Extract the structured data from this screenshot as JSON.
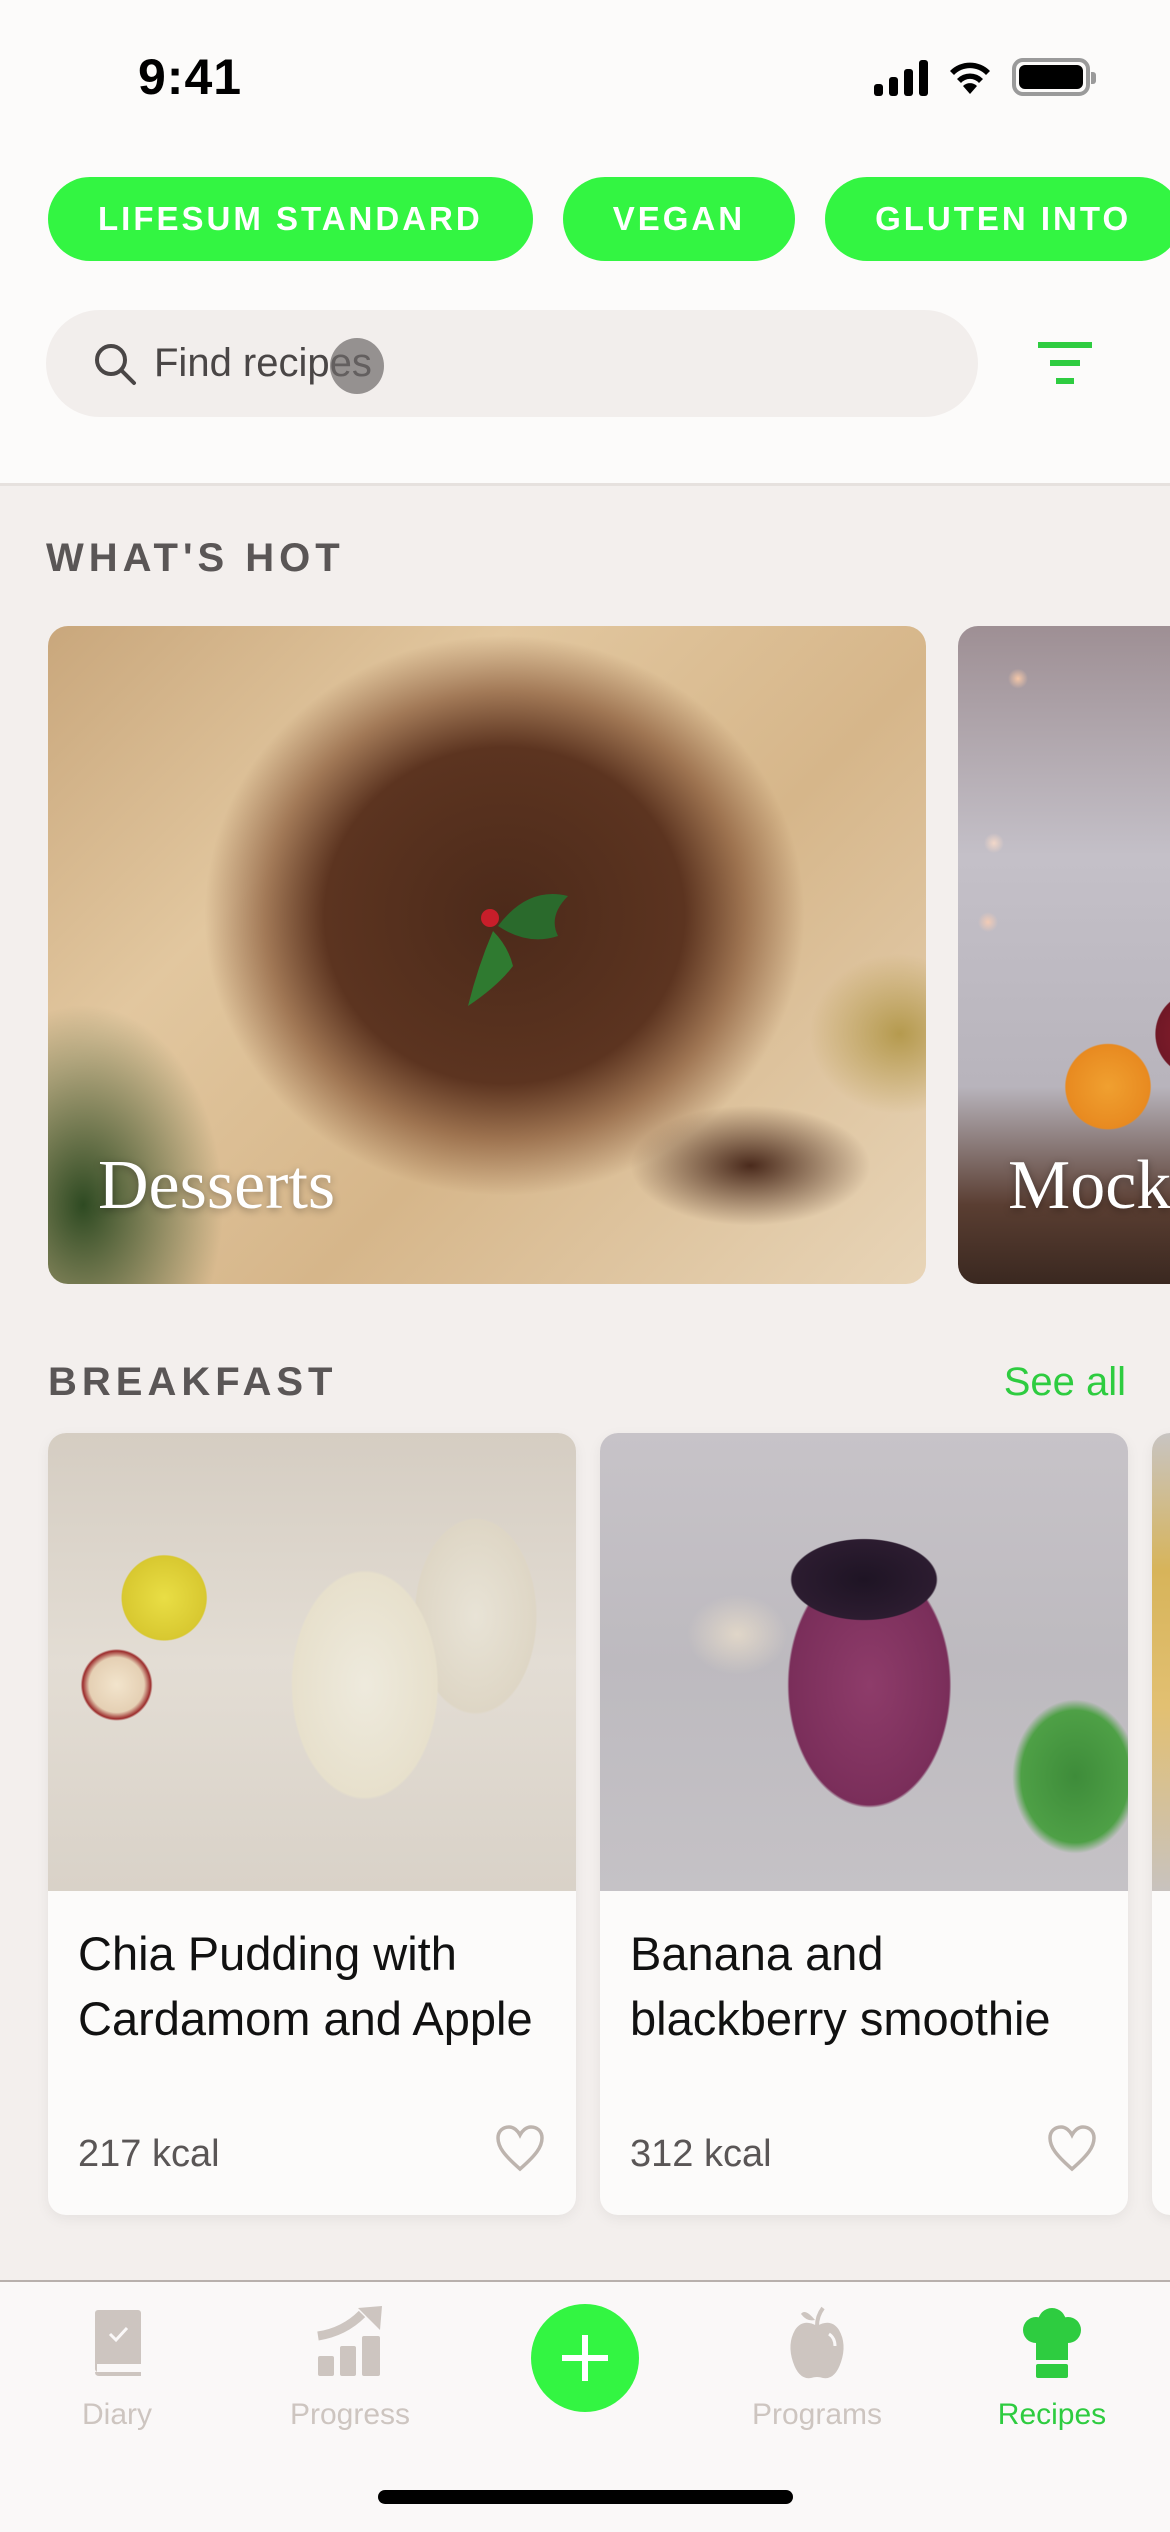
{
  "status_bar": {
    "time": "9:41",
    "icons": [
      "cellular-signal-icon",
      "wifi-icon",
      "battery-icon"
    ]
  },
  "diet_filters": [
    {
      "label": "LIFESUM STANDARD"
    },
    {
      "label": "VEGAN"
    },
    {
      "label": "GLUTEN INTO"
    }
  ],
  "search": {
    "placeholder": "Find recipes",
    "value": "",
    "icon": "search-icon",
    "filter_icon": "filter-icon"
  },
  "whats_hot": {
    "title": "WHAT'S HOT",
    "cards": [
      {
        "label": "Desserts"
      },
      {
        "label": "Mock"
      }
    ]
  },
  "breakfast": {
    "title": "BREAKFAST",
    "see_all_label": "See all",
    "recipes": [
      {
        "name": "Chia Pudding with Cardamom and Apple",
        "kcal": "217 kcal",
        "favorite": false
      },
      {
        "name": "Banana and blackberry smoothie",
        "kcal": "312 kcal",
        "favorite": false
      }
    ]
  },
  "tab_bar": {
    "items": [
      {
        "label": "Diary",
        "icon": "diary-book-icon",
        "active": false
      },
      {
        "label": "Progress",
        "icon": "progress-chart-icon",
        "active": false
      },
      {
        "label": "",
        "icon": "plus-icon",
        "active": false
      },
      {
        "label": "Programs",
        "icon": "apple-icon",
        "active": false
      },
      {
        "label": "Recipes",
        "icon": "chef-hat-icon",
        "active": true
      }
    ]
  },
  "colors": {
    "accent_green": "#33f542",
    "link_green": "#2ecc40",
    "inactive_tab": "#cdc5c0",
    "background": "#f3efed"
  }
}
